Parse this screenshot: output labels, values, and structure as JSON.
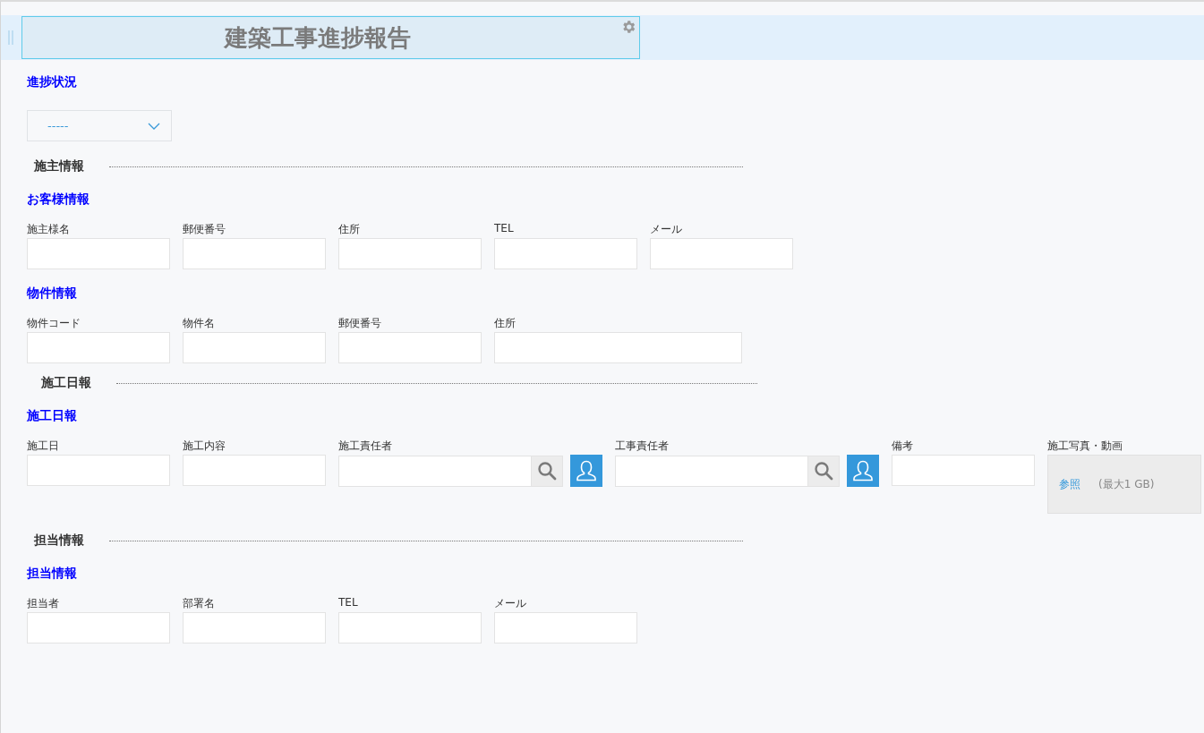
{
  "header": {
    "title": "建築工事進捗報告"
  },
  "status": {
    "label": "進捗状況",
    "dropdown": {
      "value": "-----"
    }
  },
  "sections": [
    {
      "heading": "施主情報",
      "groups": [
        {
          "label": "お客様情報",
          "fields": [
            {
              "kind": "text",
              "label": "施主様名"
            },
            {
              "kind": "text",
              "label": "郵便番号"
            },
            {
              "kind": "text",
              "label": "住所"
            },
            {
              "kind": "text",
              "label": "TEL"
            },
            {
              "kind": "text",
              "label": "メール"
            }
          ]
        },
        {
          "label": "物件情報",
          "fields": [
            {
              "kind": "text",
              "label": "物件コード"
            },
            {
              "kind": "text",
              "label": "物件名"
            },
            {
              "kind": "text",
              "label": "郵便番号"
            },
            {
              "kind": "wide",
              "label": "住所"
            }
          ]
        }
      ]
    },
    {
      "heading": "施工日報",
      "groups": [
        {
          "label": "施工日報",
          "fields": [
            {
              "kind": "text",
              "label": "施工日"
            },
            {
              "kind": "text",
              "label": "施工内容"
            },
            {
              "kind": "user",
              "label": "施工責任者"
            },
            {
              "kind": "user",
              "label": "工事責任者"
            },
            {
              "kind": "text",
              "label": "備考"
            },
            {
              "kind": "file",
              "label": "施工写真・動画",
              "link": "参照",
              "note": "(最大1 GB)"
            }
          ]
        }
      ]
    },
    {
      "heading": "担当情報",
      "groups": [
        {
          "label": "担当情報",
          "fields": [
            {
              "kind": "text",
              "label": "担当者"
            },
            {
              "kind": "text",
              "label": "部署名"
            },
            {
              "kind": "text",
              "label": "TEL"
            },
            {
              "kind": "text",
              "label": "メール"
            }
          ]
        }
      ]
    }
  ]
}
